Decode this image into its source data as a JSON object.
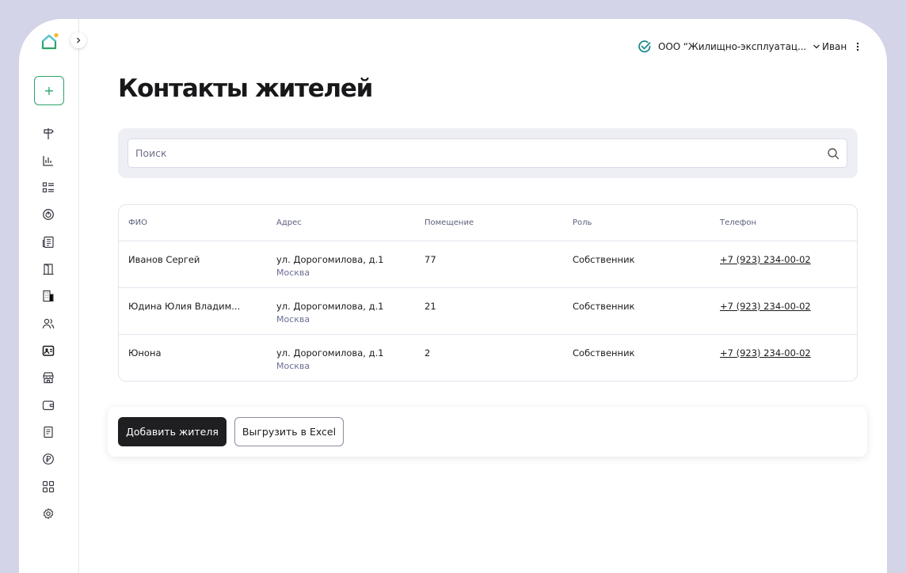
{
  "header": {
    "org_name": "ООО “Жилищно-эксплуатац...",
    "user_name": "Иван"
  },
  "page": {
    "title": "Контакты жителей"
  },
  "search": {
    "placeholder": "Поиск"
  },
  "table": {
    "columns": [
      "ФИО",
      "Адрес",
      "Помещение",
      "Роль",
      "Телефон"
    ],
    "rows": [
      {
        "name": "Иванов Сергей",
        "address": "ул. Дорогомилова, д.1",
        "city": "Москва",
        "room": "77",
        "role": "Собственник",
        "phone": "+7 (923) 234-00-02"
      },
      {
        "name": "Юдина Юлия Владим...",
        "address": "ул. Дорогомилова, д.1",
        "city": "Москва",
        "room": "21",
        "role": "Собственник",
        "phone": "+7 (923) 234-00-02"
      },
      {
        "name": "Юнона",
        "address": "ул. Дорогомилова, д.1",
        "city": "Москва",
        "room": "2",
        "role": "Собственник",
        "phone": "+7 (923) 234-00-02"
      }
    ]
  },
  "actions": {
    "add_label": "Добавить жителя",
    "export_label": "Выгрузить в Excel"
  },
  "sidebar": {
    "add_label": "+",
    "icons": [
      "signpost-icon",
      "bar-chart-icon",
      "list-icon",
      "power-icon",
      "newspaper-icon",
      "door-icon",
      "building-icon",
      "users-icon",
      "contact-card-icon",
      "store-icon",
      "wallet-icon",
      "document-icon",
      "ruble-icon",
      "grid-icon",
      "settings-icon"
    ]
  },
  "colors": {
    "accent": "#2fa36b",
    "logo_dot": "#f5b921",
    "primary_button": "#1f1f21"
  }
}
